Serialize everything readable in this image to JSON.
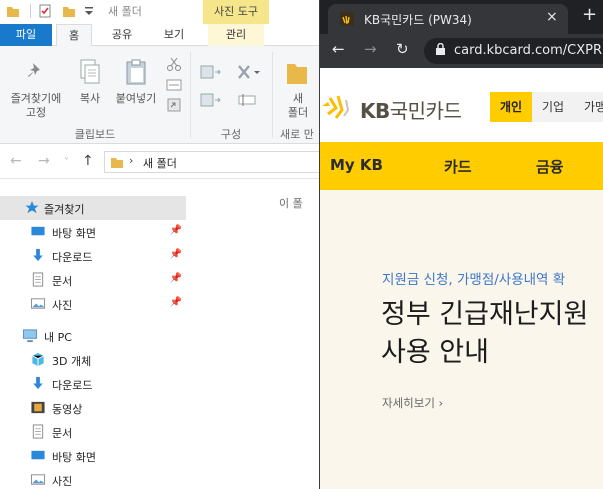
{
  "explorer": {
    "window_title": "새 폴더",
    "context_tab_group": "사진 도구",
    "ribbon_tabs": [
      "파일",
      "홈",
      "공유",
      "보기",
      "관리"
    ],
    "ribbon": {
      "pin_label": "즐겨찾기에\n고정",
      "copy_label": "복사",
      "paste_label": "붙여넣기",
      "clipboard_group": "클립보드",
      "organize_group": "구성",
      "new_folder_label": "새\n폴더",
      "new_group": "새로 만"
    },
    "address": {
      "path_sep": "›",
      "path": "새 폴더"
    },
    "empty_message": "이 폴",
    "nav": {
      "quick_access": "즐겨찾기",
      "quick_items": [
        "바탕 화면",
        "다운로드",
        "문서",
        "사진"
      ],
      "this_pc": "내 PC",
      "pc_items": [
        "3D 개체",
        "다운로드",
        "동영상",
        "문서",
        "바탕 화면",
        "사진"
      ]
    }
  },
  "chrome": {
    "tab_title": "KB국민카드 (PW34)",
    "tab_close": "×",
    "new_tab": "+",
    "url": "card.kbcard.com/CXPR",
    "back": "←",
    "forward": "→",
    "reload": "↻"
  },
  "kb": {
    "logo_kb": "KB",
    "logo_name": "국민카드",
    "segments": [
      "개인",
      "기업",
      "가맹"
    ],
    "nav": [
      "My KB",
      "카드",
      "금융"
    ],
    "hero_sub": "지원금 신청, 가맹점/사용내역 확",
    "hero_title_line1": "정부 긴급재난지원",
    "hero_title_line2": "사용 안내",
    "hero_link": "자세히보기 ›"
  },
  "colors": {
    "kb_yellow": "#ffcc00",
    "explorer_file_tab": "#1979ca",
    "chrome_dark": "#202124",
    "chrome_toolbar": "#35363a",
    "hero_bg": "#faf6ec",
    "hero_sub": "#3d78c8"
  }
}
